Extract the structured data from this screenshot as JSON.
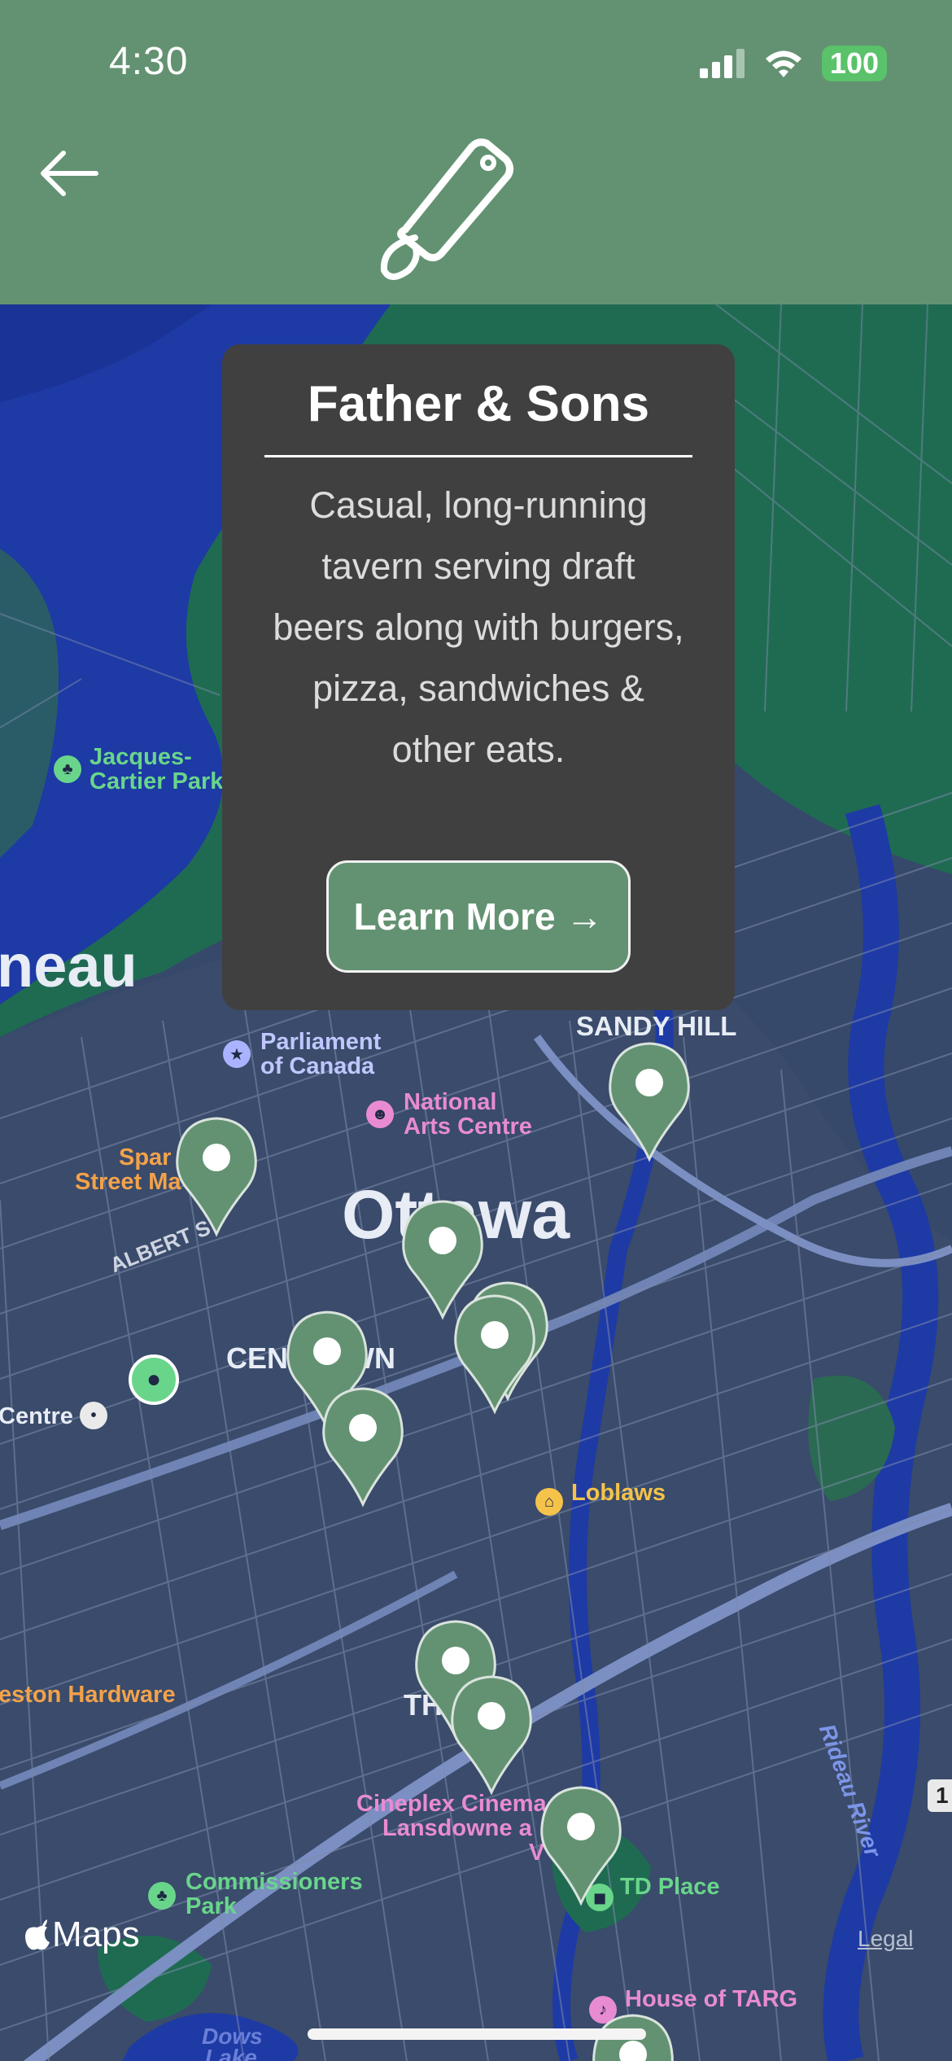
{
  "status_bar": {
    "time": "4:30",
    "battery": "100"
  },
  "header": {
    "back_icon": "arrow-left-icon",
    "logo_icon": "price-tag-icon",
    "color": "#639272"
  },
  "popup": {
    "title": "Father & Sons",
    "description": "Casual, long-running tavern serving draft beers along with burgers, pizza, sandwiches & other eats.",
    "button_label": "Learn More →"
  },
  "map": {
    "labels": {
      "gatineau": "neau",
      "ottawa": "Ottawa",
      "jacques_cartier_1": "Jacques-",
      "jacques_cartier_2": "Cartier Park",
      "sandy_hill": "SANDY HILL",
      "parliament_1": "Parliament",
      "parliament_2": "of Canada",
      "nac_1": "National",
      "nac_2": "Arts Centre",
      "sparks_1": "Spar",
      "sparks_2": "Street Ma",
      "albert": "ALBERT S",
      "centretown": "CENT     WN",
      "centre": "Centre",
      "loblaws": "Loblaws",
      "preston": "eston Hardware",
      "glebe": "TH       E",
      "cineplex_1": "Cineplex Cinema",
      "cineplex_2": "Lansdowne a",
      "cineplex_3": "V",
      "commissioners_1": "Commissioners",
      "commissioners_2": "Park",
      "td_place": "TD Place",
      "house_targ": "House of TARG",
      "dows_1": "Dows",
      "dows_2": "Lake",
      "rideau_river": "Rideau River",
      "highway": "1"
    },
    "attribution": "Maps",
    "legal": "Legal"
  },
  "colors": {
    "pin": "#639272",
    "water": "#1f3c9e",
    "park": "#1f6a4e",
    "land": "#3a4d6a"
  }
}
